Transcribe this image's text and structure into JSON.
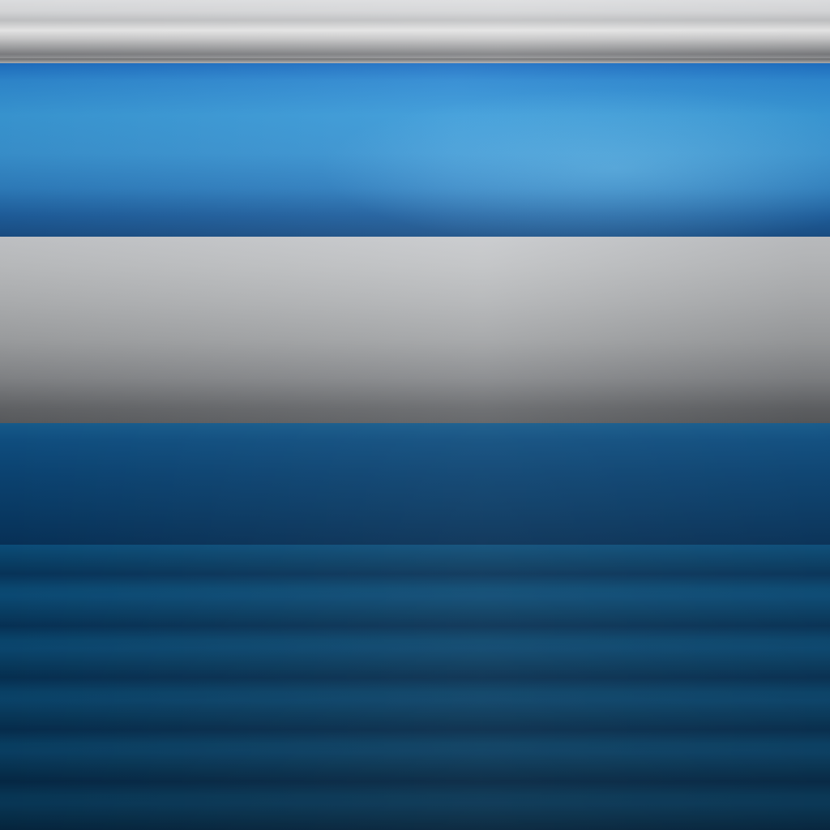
{
  "colors": {
    "top_rail": "#cfd0d2",
    "blue_band": "#3a9ad8",
    "silver_band": "#b1b3b5",
    "dark_panel": "#0b4270",
    "stripes": "#0b4c78"
  }
}
